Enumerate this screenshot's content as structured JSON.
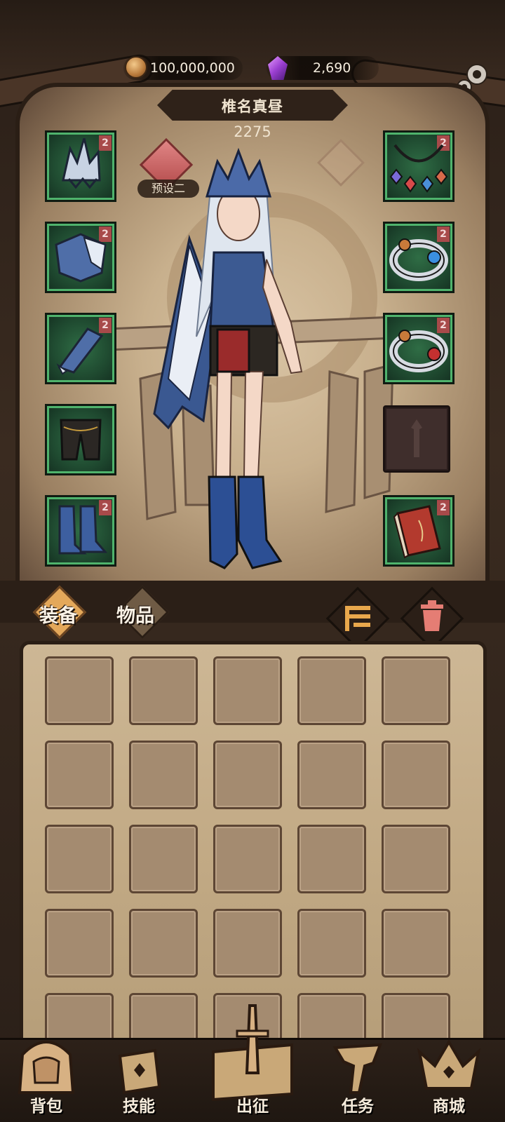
{
  "currency": {
    "gold": "100,000,000",
    "gems": "2,690"
  },
  "character": {
    "name": "椎名真昼",
    "power": "2275",
    "preset_label": "预设二"
  },
  "equipment_left": [
    {
      "slot": "helmet",
      "level": "2",
      "icon": "crown-helmet-icon"
    },
    {
      "slot": "armor",
      "level": "2",
      "icon": "shoulder-armor-icon"
    },
    {
      "slot": "gloves",
      "level": "2",
      "icon": "gauntlet-icon"
    },
    {
      "slot": "pants",
      "level": "",
      "icon": "pants-icon"
    },
    {
      "slot": "boots",
      "level": "2",
      "icon": "boots-icon"
    }
  ],
  "equipment_right": [
    {
      "slot": "necklace",
      "level": "2",
      "icon": "necklace-icon"
    },
    {
      "slot": "ring-1",
      "level": "2",
      "icon": "ring-icon"
    },
    {
      "slot": "ring-2",
      "level": "2",
      "icon": "ring-icon"
    },
    {
      "slot": "empty",
      "level": "",
      "icon": "empty-slot-icon"
    },
    {
      "slot": "book",
      "level": "2",
      "icon": "spellbook-icon"
    }
  ],
  "tabs": {
    "equipment": "装备",
    "items": "物品"
  },
  "toolbar": {
    "sort_icon": "sort-icon",
    "trash_icon": "trash-icon"
  },
  "nav": {
    "backpack": "背包",
    "skills": "技能",
    "expedition": "出征",
    "quests": "任务",
    "shop": "商城"
  },
  "colors": {
    "slot_green": "#2f6d45",
    "level_badge": "#a84a4a",
    "panel_parchment": "#c2aa85"
  }
}
